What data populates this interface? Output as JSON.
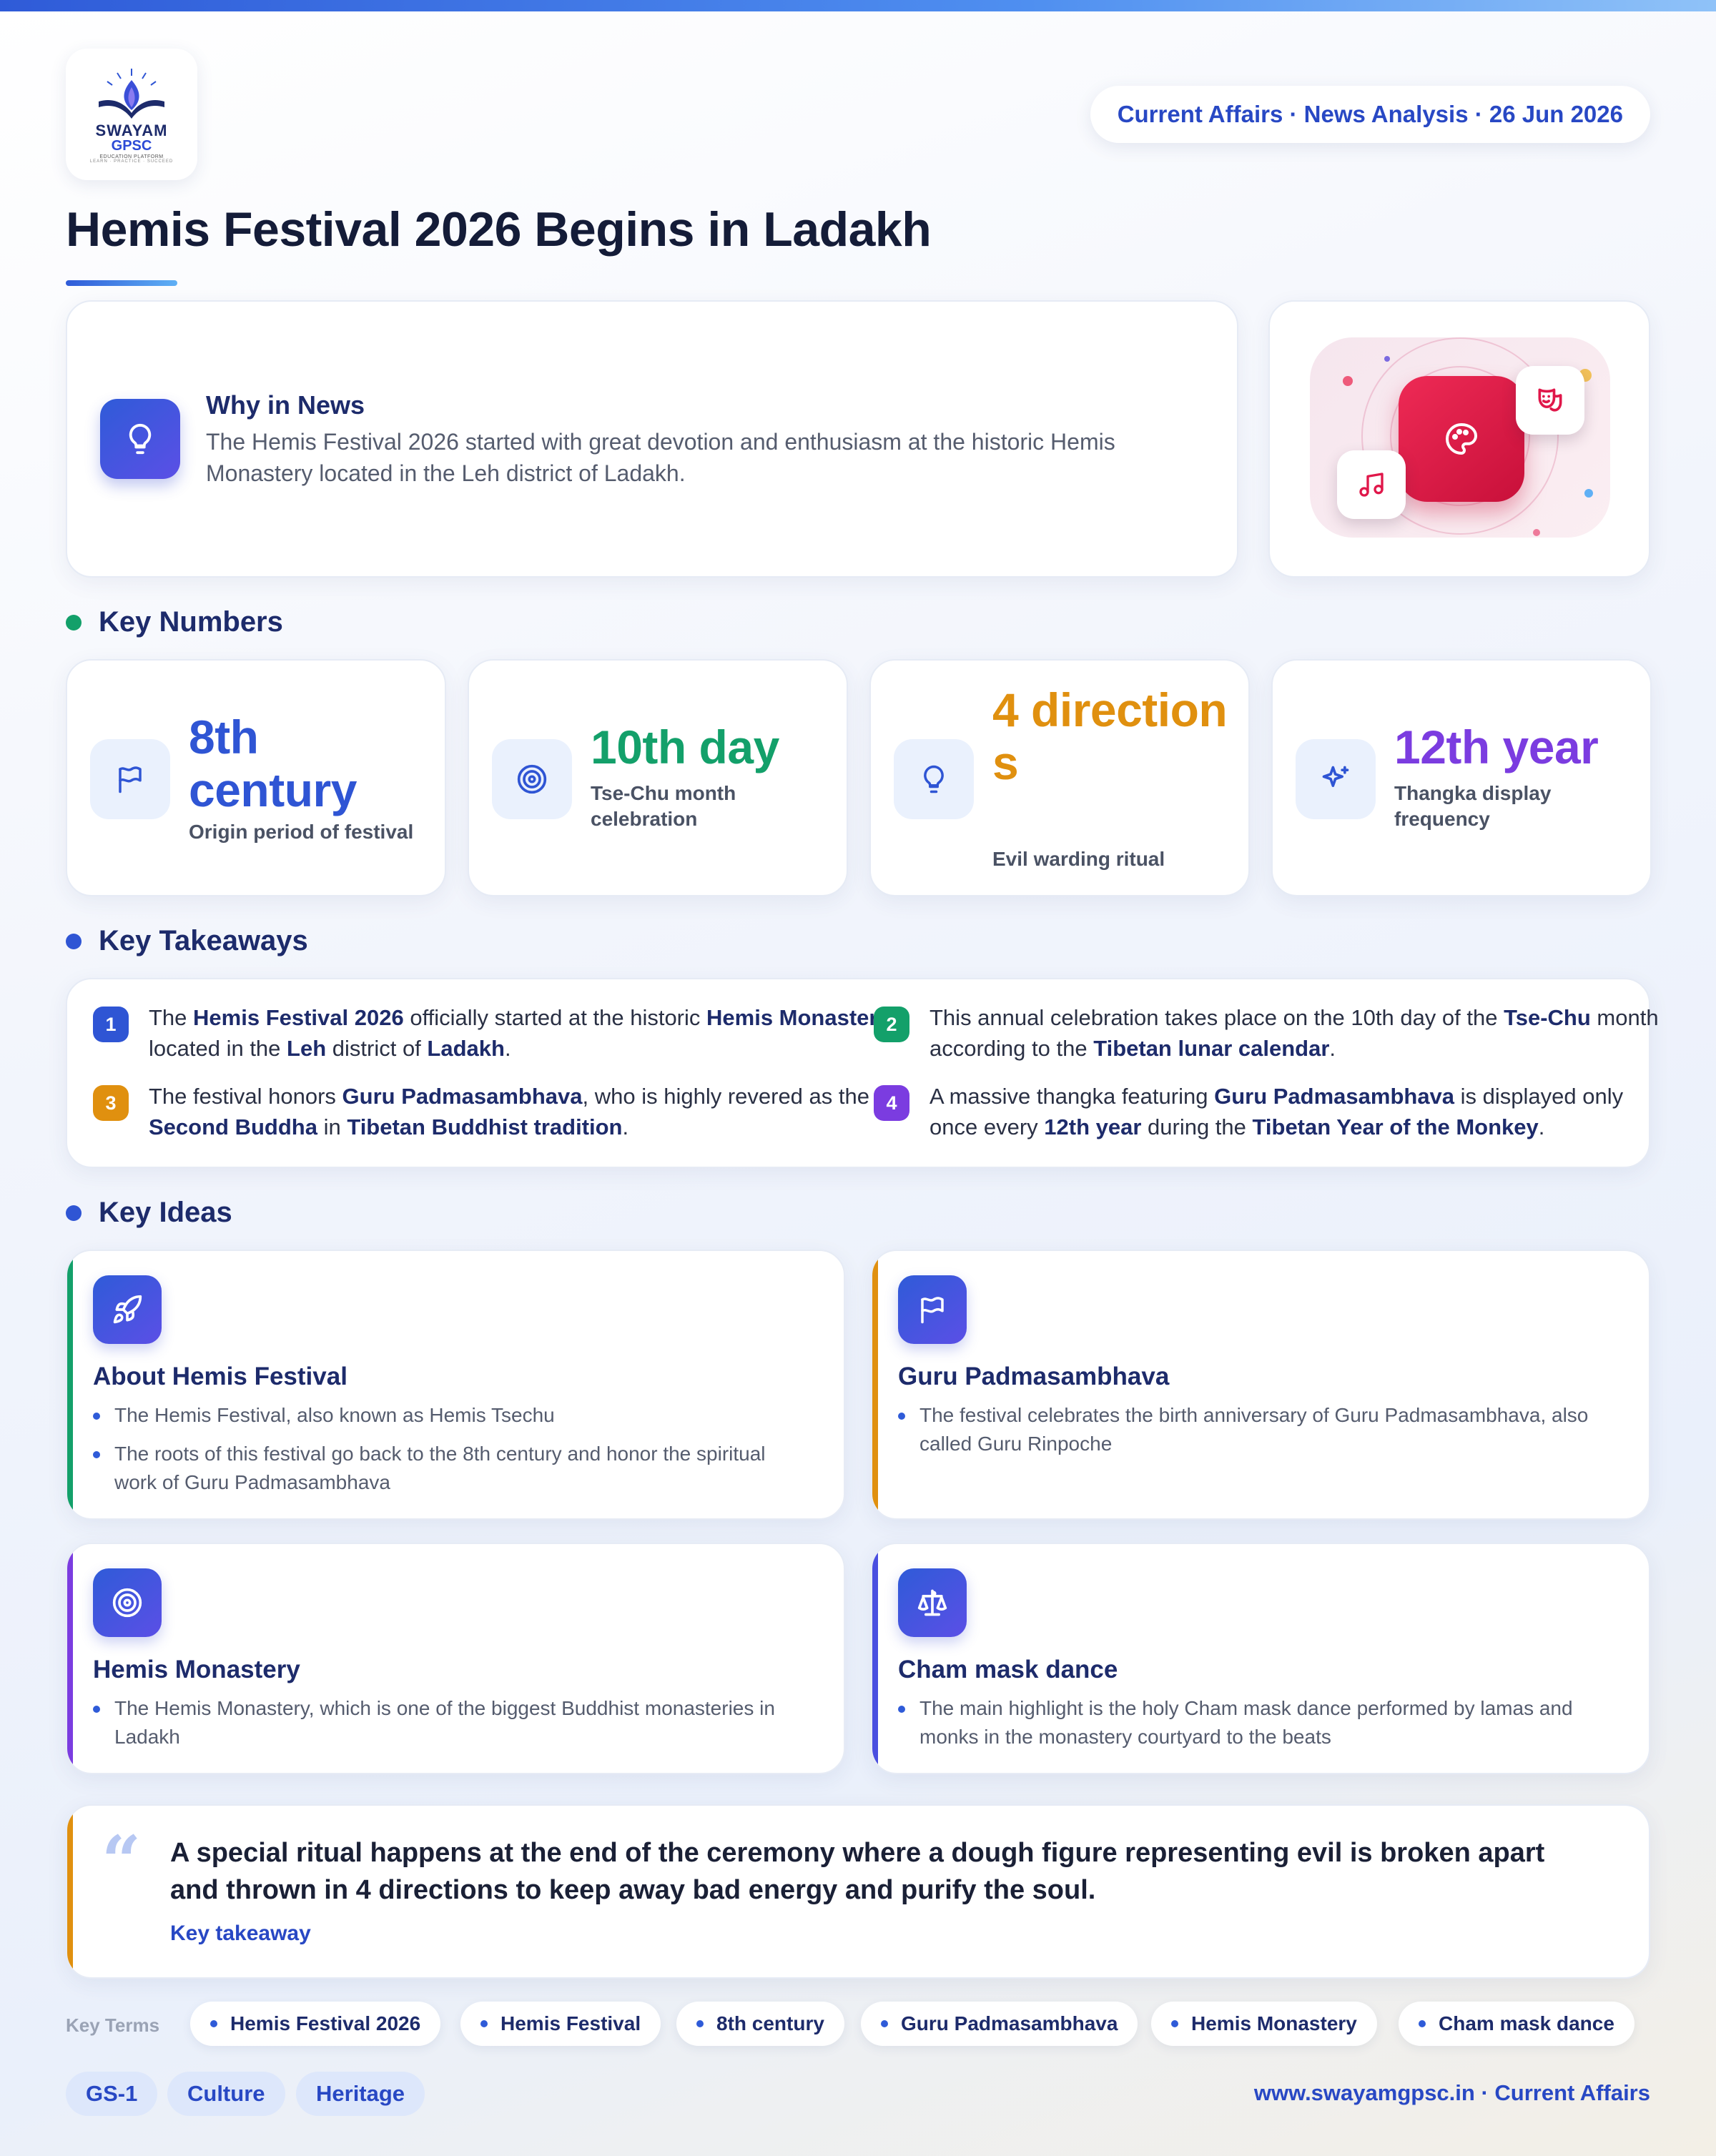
{
  "logo": {
    "name": "SWAYAM",
    "sub": "GPSC",
    "tagline": "EDUCATION PLATFORM",
    "tagline2": "LEARN · PRACTICE · SUCCEED"
  },
  "header": {
    "date_pill": "Current Affairs · News Analysis · 26 Jun 2026",
    "title": "Hemis Festival 2026 Begins in Ladakh"
  },
  "why": {
    "heading": "Why in News",
    "text": "The Hemis Festival 2026 started with great devotion and enthusiasm at the historic Hemis Monastery located in the Leh district of Ladakh."
  },
  "illustration": {
    "main_icon": "palette-icon",
    "icons": [
      "theater-masks-icon",
      "music-note-icon"
    ],
    "accent": "#e0174a"
  },
  "key_numbers": {
    "label": "Key Numbers",
    "items": [
      {
        "value": "8th century",
        "label": "Origin period of festival",
        "icon": "flag-icon",
        "color": "#2f55d4"
      },
      {
        "value": "10th day",
        "label": "Tse-Chu month celebration",
        "icon": "target-icon",
        "color": "#13a06a"
      },
      {
        "value": "4 directions",
        "label": "Evil warding ritual",
        "icon": "lightbulb-icon",
        "color": "#e0900f"
      },
      {
        "value": "12th year",
        "label": "Thangka display frequency",
        "icon": "sparkle-icon",
        "color": "#7b3ce0"
      }
    ]
  },
  "takeaways": {
    "label": "Key Takeaways",
    "items": [
      {
        "num": "1",
        "color": "#2f55d4",
        "segments": [
          [
            "The ",
            false
          ],
          [
            "Hemis Festival 2026",
            true
          ],
          [
            " officially started at the historic ",
            false
          ],
          [
            "Hemis Monastery",
            true
          ],
          [
            " located in the ",
            false
          ],
          [
            "Leh",
            true
          ],
          [
            " district of ",
            false
          ],
          [
            "Ladakh",
            true
          ],
          [
            ".",
            false
          ]
        ]
      },
      {
        "num": "2",
        "color": "#13a06a",
        "segments": [
          [
            "This annual celebration takes place on the 10th day of the ",
            false
          ],
          [
            "Tse-Chu",
            true
          ],
          [
            " month according to the ",
            false
          ],
          [
            "Tibetan lunar calendar",
            true
          ],
          [
            ".",
            false
          ]
        ]
      },
      {
        "num": "3",
        "color": "#e0900f",
        "segments": [
          [
            "The festival honors ",
            false
          ],
          [
            "Guru Padmasambhava",
            true
          ],
          [
            ", who is highly revered as the ",
            false
          ],
          [
            "Second Buddha",
            true
          ],
          [
            " in ",
            false
          ],
          [
            "Tibetan Buddhist tradition",
            true
          ],
          [
            ".",
            false
          ]
        ]
      },
      {
        "num": "4",
        "color": "#7b3ce0",
        "segments": [
          [
            "A massive thangka featuring ",
            false
          ],
          [
            "Guru Padmasambhava",
            true
          ],
          [
            " is displayed only once every ",
            false
          ],
          [
            "12th year",
            true
          ],
          [
            " during the ",
            false
          ],
          [
            "Tibetan Year of the Monkey",
            true
          ],
          [
            ".",
            false
          ]
        ]
      }
    ]
  },
  "ideas": {
    "label": "Key Ideas",
    "items": [
      {
        "title": "About Hemis Festival",
        "icon": "rocket-icon",
        "accent": "#13a06a",
        "bullets": [
          "The Hemis Festival, also known as Hemis Tsechu",
          "The roots of this festival go back to the 8th century and honor the spiritual work of Guru Padmasambhava"
        ]
      },
      {
        "title": "Guru Padmasambhava",
        "icon": "flag-icon",
        "accent": "#e0900f",
        "bullets": [
          "The festival celebrates the birth anniversary of Guru Padmasambhava, also called Guru Rinpoche"
        ]
      },
      {
        "title": "Hemis Monastery",
        "icon": "target-icon",
        "accent": "#7b3ce0",
        "bullets": [
          "The Hemis Monastery, which is one of the biggest Buddhist monasteries in Ladakh"
        ]
      },
      {
        "title": "Cham mask dance",
        "icon": "scale-icon",
        "accent": "#4a4fe0",
        "bullets": [
          "The main highlight is the holy Cham mask dance performed by lamas and monks in the monastery courtyard to the beats"
        ]
      }
    ]
  },
  "quote": {
    "mark": "“",
    "text": "A special ritual happens at the end of the ceremony where a dough figure representing evil is broken apart and thrown in 4 directions to keep away bad energy and purify the soul.",
    "cite": "Key takeaway",
    "accent": "#e0900f"
  },
  "key_terms": {
    "label": "Key Terms",
    "items": [
      "Hemis Festival 2026",
      "Hemis Festival",
      "8th century",
      "Guru Padmasambhava",
      "Hemis Monastery",
      "Cham mask dance"
    ]
  },
  "tags": [
    "GS-1",
    "Culture",
    "Heritage"
  ],
  "footer": {
    "url": "www.swayamgpsc.in · Current Affairs"
  }
}
